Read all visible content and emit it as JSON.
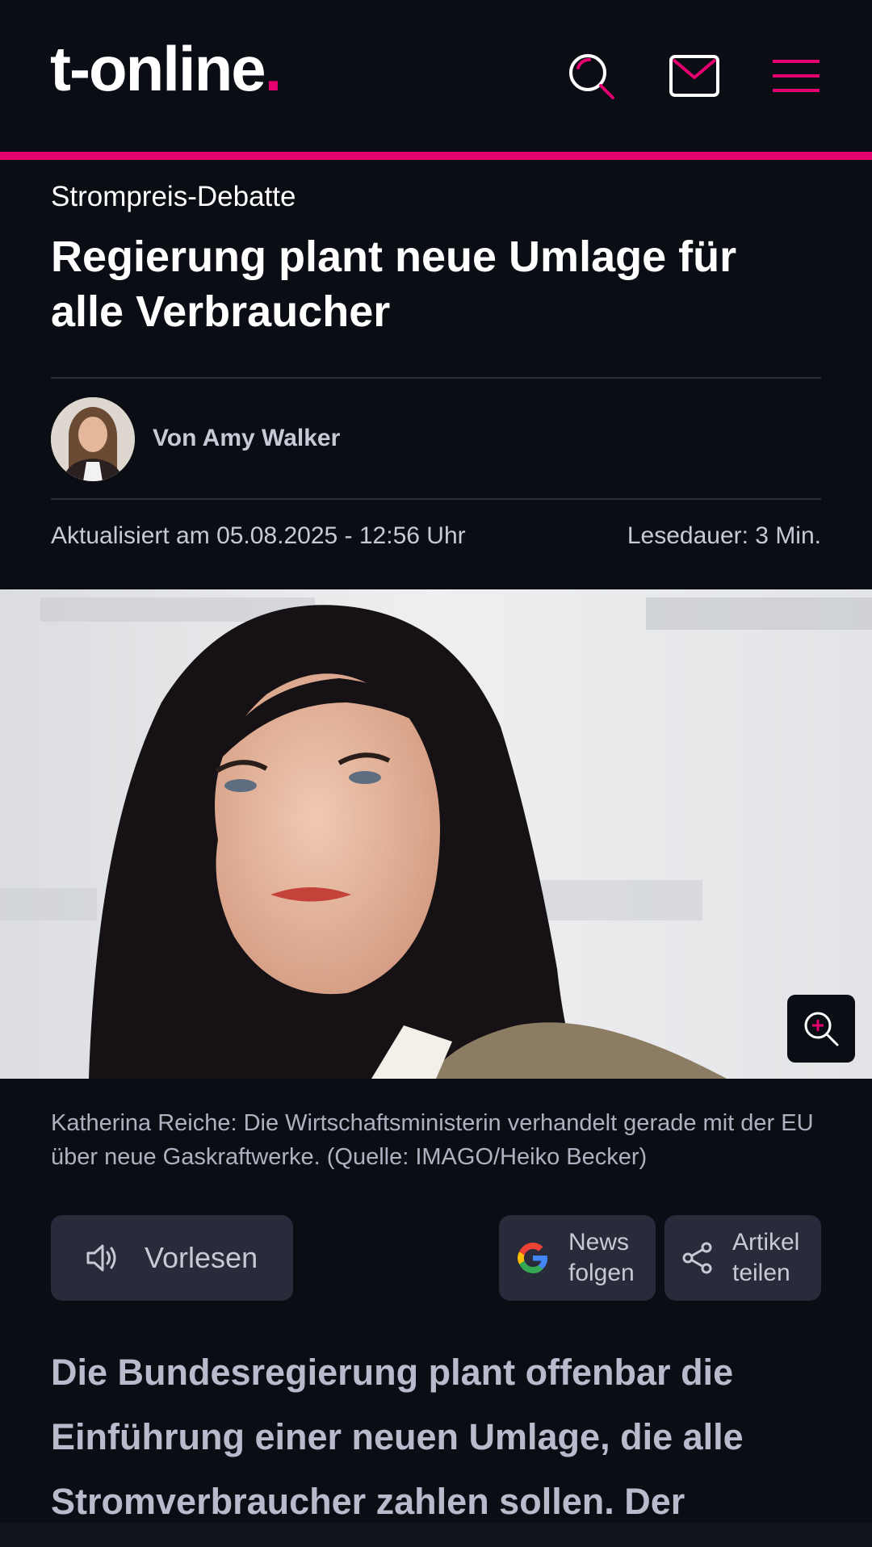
{
  "header": {
    "logo_text": "t-online",
    "logo_dot": ".",
    "accent_color": "#e5006f",
    "icons": [
      "search-icon",
      "mail-icon",
      "menu-icon"
    ]
  },
  "article": {
    "kicker": "Strompreis-Debatte",
    "headline": "Regierung plant neue Umlage für alle Verbraucher",
    "author": "Von Amy Walker",
    "updated": "Aktualisiert am 05.08.2025 - 12:56 Uhr",
    "reading_time": "Lesedauer: 3 Min.",
    "image_caption": "Katherina Reiche: Die Wirtschaftsministerin verhandelt gerade mit der EU über neue Gaskraftwerke. (Quelle: IMAGO/Heiko Becker)",
    "lead": "Die Bundesregierung plant offenbar die Einführung einer neuen Umlage, die alle Stromverbraucher zahlen sollen. Der"
  },
  "actions": {
    "read_aloud": "Vorlesen",
    "news_line1": "News",
    "news_line2": "folgen",
    "share_line1": "Artikel",
    "share_line2": "teilen"
  },
  "colors": {
    "background": "#0b0d14",
    "button_bg": "#272b3a",
    "muted_text": "#c7cad6"
  }
}
